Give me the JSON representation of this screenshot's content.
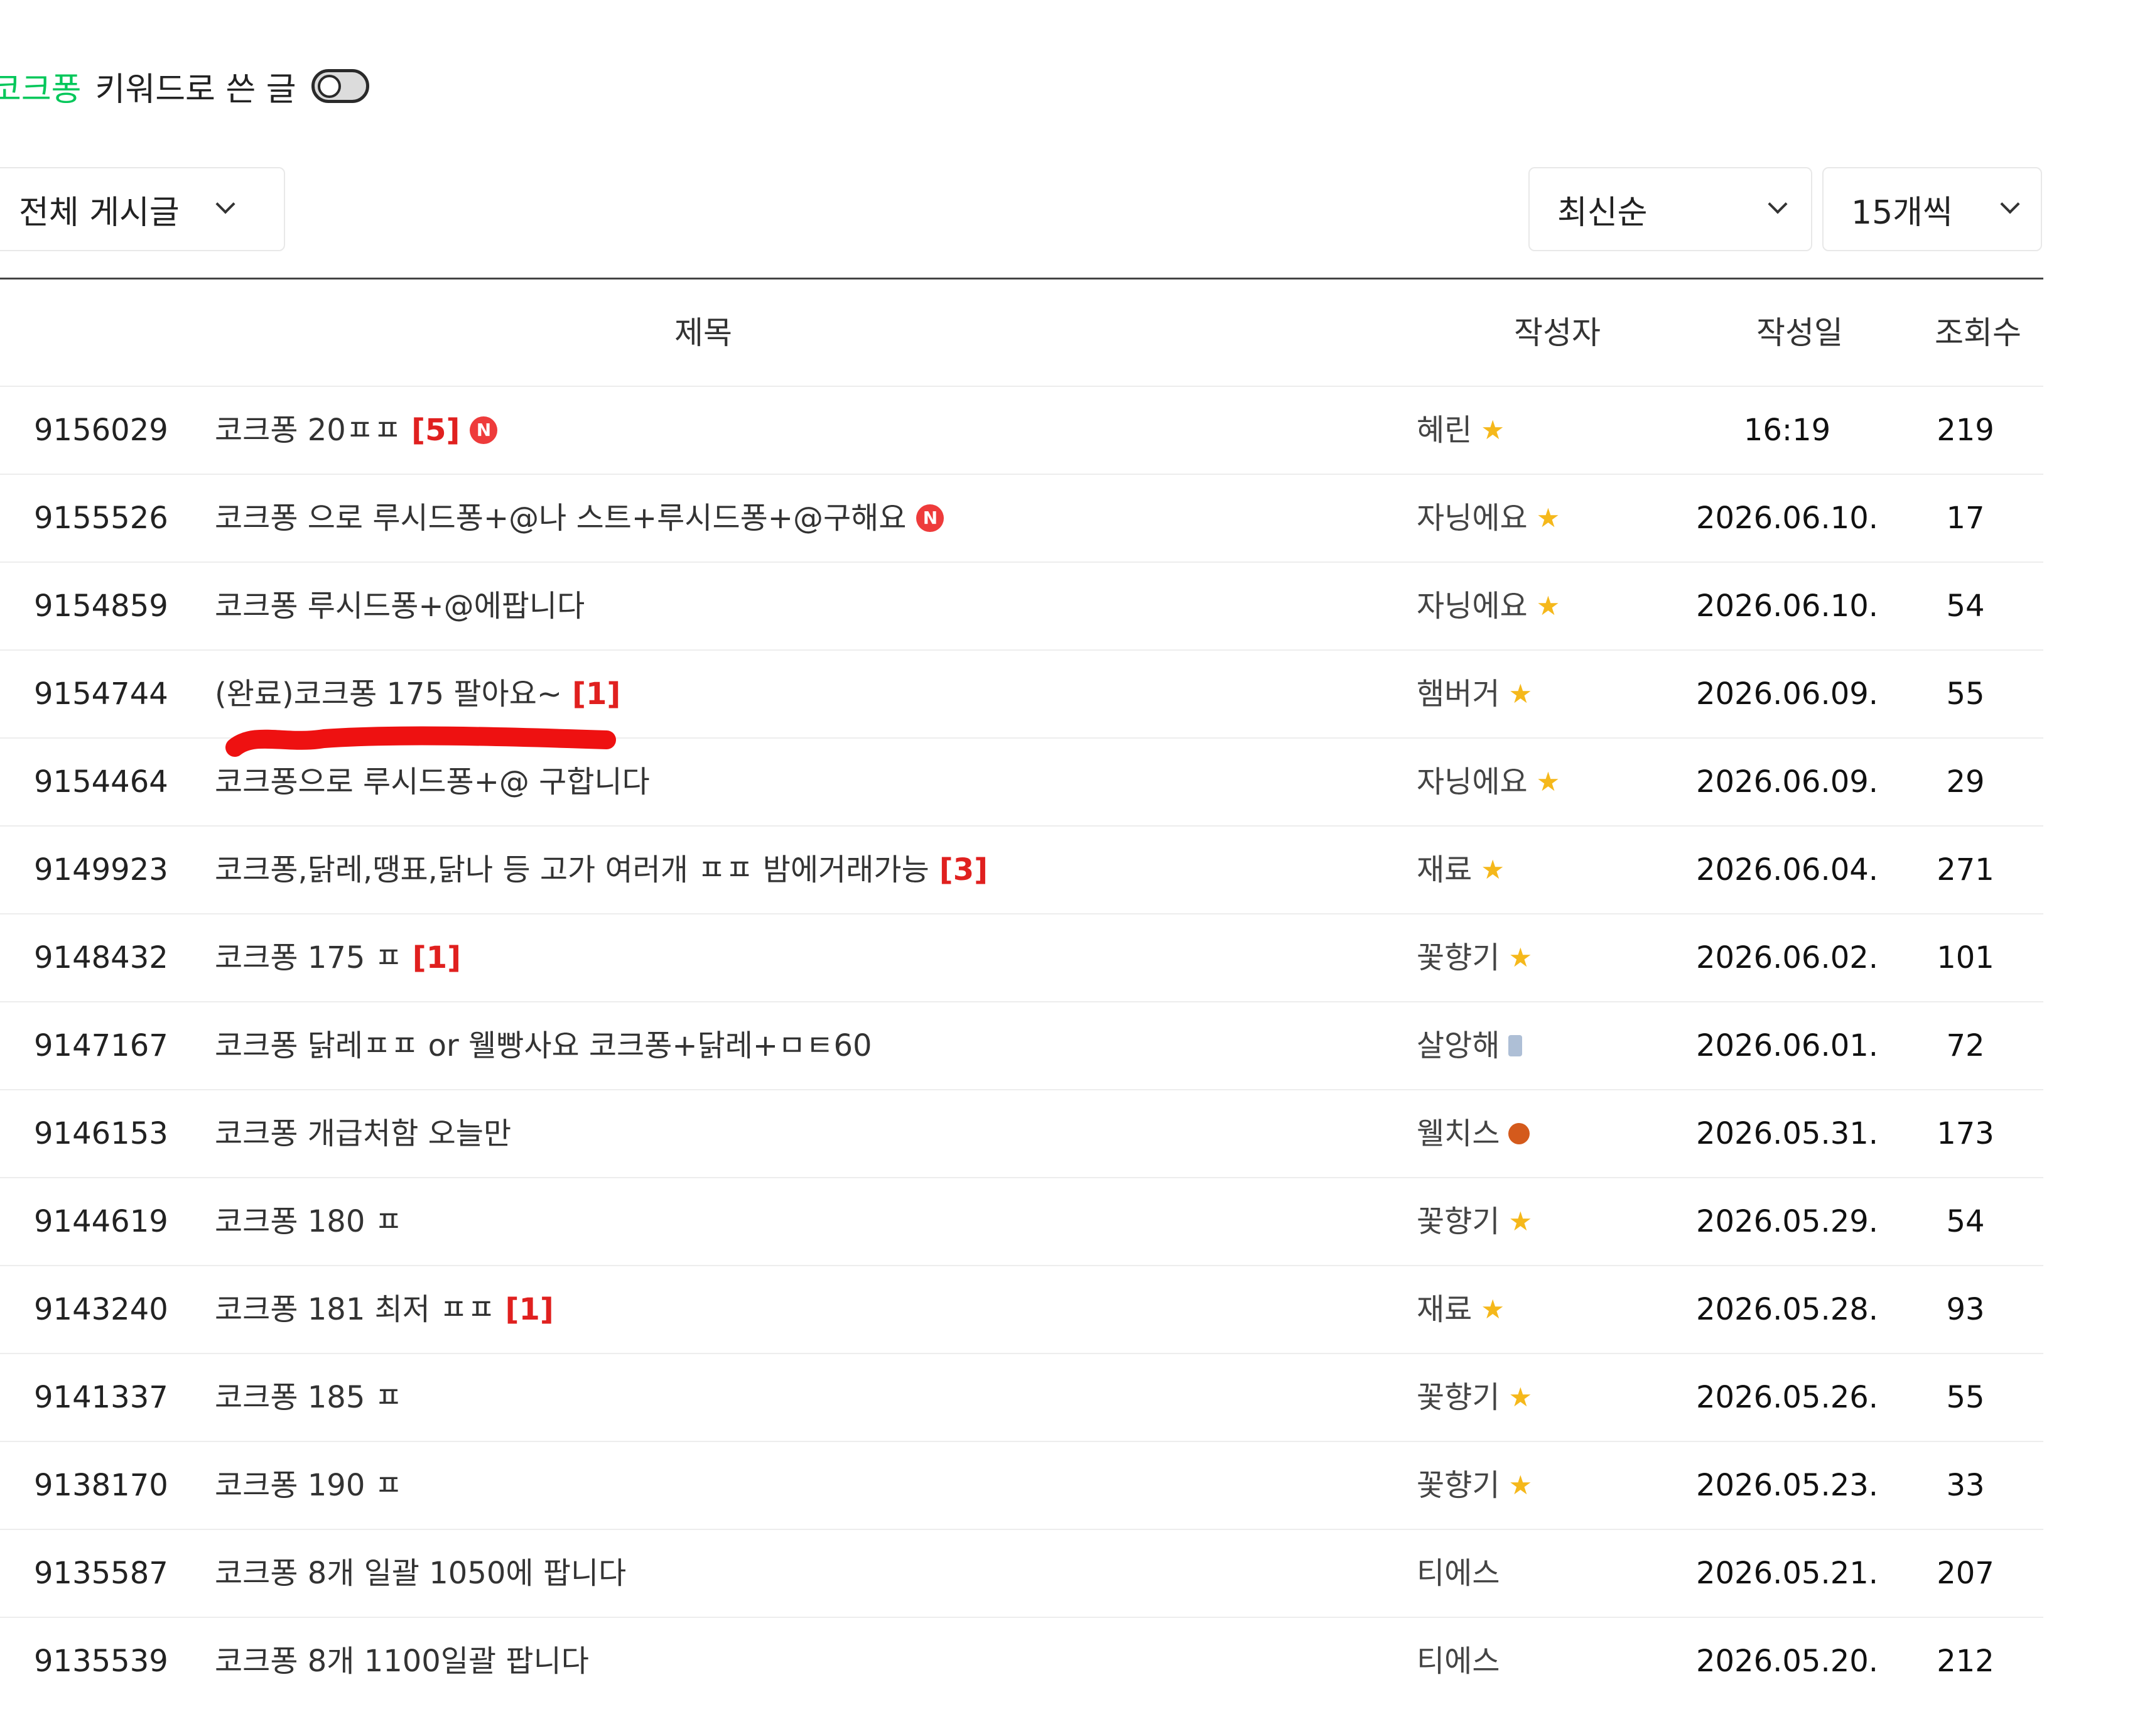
{
  "keyword_bar": {
    "keyword": "코크퐁",
    "suffix": "키워드로 쓴 글",
    "toggle_on": false
  },
  "filters": {
    "board": "전체 게시글",
    "sort": "최신순",
    "per_page": "15개씩"
  },
  "columns": {
    "title": "제목",
    "author": "작성자",
    "date": "작성일",
    "views": "조회수"
  },
  "colors": {
    "accent_green": "#03c75a",
    "comment_red": "#e0201f",
    "new_badge": "#ee3b3b",
    "star": "#f5b81b",
    "pen_mark": "#ee1111"
  },
  "rows": [
    {
      "no": "9156029",
      "title": "코크퐁 20ㅍㅍ",
      "comments": "[5]",
      "new": true,
      "new_label": "N",
      "author": "혜린",
      "grade_icon": "star-icon",
      "date": "16:19",
      "views": "219"
    },
    {
      "no": "9155526",
      "title": "코크퐁 으로 루시드퐁+@나 스트+루시드퐁+@구해요",
      "comments": "",
      "new": true,
      "new_label": "N",
      "author": "자닝에요",
      "grade_icon": "star-icon",
      "date": "2026.06.10.",
      "views": "17"
    },
    {
      "no": "9154859",
      "title": "코크퐁 루시드퐁+@에팝니다",
      "comments": "",
      "new": false,
      "author": "자닝에요",
      "grade_icon": "star-icon",
      "date": "2026.06.10.",
      "views": "54"
    },
    {
      "no": "9154744",
      "title": "(완료)코크퐁 175 팔아요~",
      "comments": "[1]",
      "new": false,
      "author": "햄버거",
      "grade_icon": "star-icon",
      "date": "2026.06.09.",
      "views": "55"
    },
    {
      "no": "9154464",
      "title": "코크퐁으로 루시드퐁+@ 구합니다",
      "comments": "",
      "new": false,
      "author": "자닝에요",
      "grade_icon": "star-icon",
      "date": "2026.06.09.",
      "views": "29"
    },
    {
      "no": "9149923",
      "title": "코크퐁,닭레,땡표,닭나 등 고가 여러개 ㅍㅍ 밤에거래가능",
      "comments": "[3]",
      "new": false,
      "author": "재료",
      "grade_icon": "star-icon",
      "date": "2026.06.04.",
      "views": "271"
    },
    {
      "no": "9148432",
      "title": "코크퐁 175 ㅍ",
      "comments": "[1]",
      "new": false,
      "author": "꽃향기",
      "grade_icon": "star-icon",
      "date": "2026.06.02.",
      "views": "101"
    },
    {
      "no": "9147167",
      "title": "코크퐁 닭레ㅍㅍ or 웰빵사요 코크퐁+닭레+ㅁㅌ60",
      "comments": "",
      "new": false,
      "author": "살앙해",
      "grade_icon": "mug-icon",
      "date": "2026.06.01.",
      "views": "72"
    },
    {
      "no": "9146153",
      "title": "코크퐁 개급처함 오늘만",
      "comments": "",
      "new": false,
      "author": "웰치스",
      "grade_icon": "ball-icon",
      "date": "2026.05.31.",
      "views": "173"
    },
    {
      "no": "9144619",
      "title": "코크퐁 180 ㅍ",
      "comments": "",
      "new": false,
      "author": "꽃향기",
      "grade_icon": "star-icon",
      "date": "2026.05.29.",
      "views": "54"
    },
    {
      "no": "9143240",
      "title": "코크퐁 181 최저 ㅍㅍ",
      "comments": "[1]",
      "new": false,
      "author": "재료",
      "grade_icon": "star-icon",
      "date": "2026.05.28.",
      "views": "93"
    },
    {
      "no": "9141337",
      "title": "코크퐁 185 ㅍ",
      "comments": "",
      "new": false,
      "author": "꽃향기",
      "grade_icon": "star-icon",
      "date": "2026.05.26.",
      "views": "55"
    },
    {
      "no": "9138170",
      "title": "코크퐁 190 ㅍ",
      "comments": "",
      "new": false,
      "author": "꽃향기",
      "grade_icon": "star-icon",
      "date": "2026.05.23.",
      "views": "33"
    },
    {
      "no": "9135587",
      "title": "코크퐁 8개 일괄 1050에 팝니다",
      "comments": "",
      "new": false,
      "author": "티에스",
      "grade_icon": "",
      "date": "2026.05.21.",
      "views": "207"
    },
    {
      "no": "9135539",
      "title": "코크퐁 8개 1100일괄 팝니다",
      "comments": "",
      "new": false,
      "author": "티에스",
      "grade_icon": "",
      "date": "2026.05.20.",
      "views": "212"
    }
  ]
}
